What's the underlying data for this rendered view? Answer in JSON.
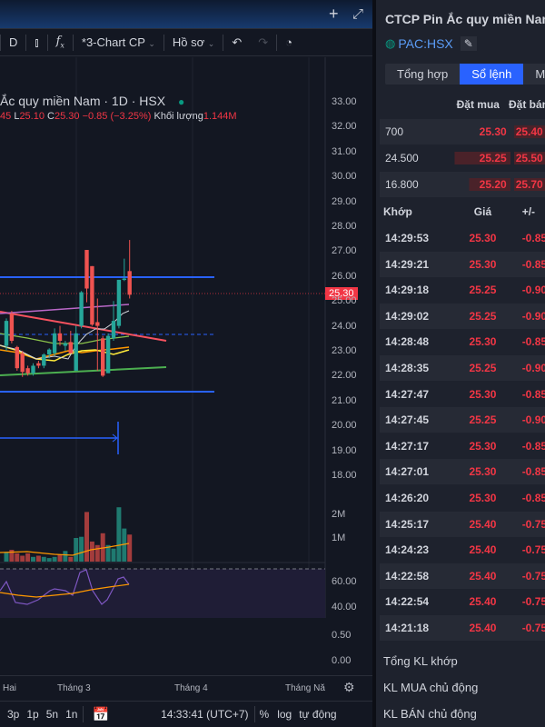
{
  "toolbar": {
    "interval": "D",
    "layout": "*3-Chart CP",
    "profile": "Hồ sơ"
  },
  "chart": {
    "title": "Ắc quy miền Nam · 1D · HSX",
    "ohlc": {
      "h": "45",
      "l_label": "L",
      "l": "25.10",
      "c_label": "C",
      "c": "25.30",
      "change": "−0.85 (−3.25%)",
      "vol_label": "Khối lượng",
      "vol": "1.144M"
    },
    "price_ticks": [
      "33.00",
      "32.00",
      "31.00",
      "30.00",
      "29.00",
      "28.00",
      "27.00",
      "26.00",
      "25.00",
      "24.00",
      "23.00",
      "22.00",
      "21.00",
      "20.00",
      "19.00",
      "18.00"
    ],
    "last_price": "25.30",
    "volume_ticks": [
      "2M",
      "1M"
    ],
    "rsi_ticks": [
      "60.00",
      "40.00"
    ],
    "macd_ticks": [
      "0.50",
      "0.00"
    ],
    "time_labels": [
      "Hai",
      "Tháng 3",
      "Tháng 4",
      "Tháng Nă"
    ]
  },
  "chart_data": {
    "type": "candlestick",
    "candles": [
      [
        23.2,
        24.3,
        23.0,
        24.2
      ],
      [
        24.5,
        24.6,
        23.3,
        23.4
      ],
      [
        23.15,
        23.2,
        22.2,
        22.3
      ],
      [
        22.9,
        23.0,
        21.95,
        22.15
      ],
      [
        22.3,
        22.4,
        22.0,
        22.1
      ],
      [
        22.1,
        22.5,
        22.0,
        22.4
      ],
      [
        22.5,
        22.6,
        22.3,
        22.4
      ],
      [
        22.4,
        22.9,
        22.3,
        22.85
      ],
      [
        22.85,
        23.1,
        22.7,
        23.05
      ],
      [
        22.9,
        23.9,
        22.8,
        23.7
      ],
      [
        23.7,
        24.0,
        23.2,
        23.4
      ],
      [
        23.2,
        23.4,
        23.0,
        23.3
      ],
      [
        23.35,
        23.8,
        22.9,
        22.9
      ],
      [
        22.2,
        24.0,
        22.2,
        23.7
      ],
      [
        24.0,
        25.4,
        23.9,
        25.35
      ],
      [
        27.05,
        27.05,
        24.95,
        25.5
      ],
      [
        26.4,
        26.4,
        24.0,
        24.05
      ],
      [
        24.15,
        25.1,
        22.2,
        24.0
      ],
      [
        23.5,
        23.6,
        21.95,
        22.0
      ],
      [
        22.1,
        23.7,
        22.1,
        23.6
      ],
      [
        23.5,
        25.0,
        23.4,
        24.2
      ],
      [
        24.0,
        25.85,
        23.9,
        25.85
      ],
      [
        25.85,
        26.7,
        25.8,
        25.9
      ],
      [
        26.2,
        27.45,
        25.1,
        25.25
      ]
    ],
    "volumes": [
      0.4,
      0.5,
      0.35,
      0.25,
      0.35,
      0.2,
      0.25,
      0.2,
      0.15,
      0.2,
      0.3,
      0.45,
      0.2,
      1.0,
      1.05,
      2.1,
      0.85,
      0.7,
      1.2,
      0.7,
      0.55,
      2.3,
      1.4,
      1.144
    ],
    "price_range": [
      18,
      33
    ]
  },
  "bottom": {
    "ranges": [
      "3p",
      "1p",
      "5n",
      "1n"
    ],
    "clock": "14:33:41 (UTC+7)",
    "percent": "%",
    "log": "log",
    "auto": "tự động"
  },
  "panel": {
    "company": "CTCP Pin Ắc quy miền Nam",
    "symbol": "PAC:HSX",
    "tabs": [
      "Tổng hợp",
      "Sổ lệnh",
      "Mức giá"
    ],
    "book_headers": [
      "Đặt mua",
      "Đặt bán"
    ],
    "book": [
      {
        "vol": "700",
        "bid": "25.30",
        "ask": "25.40"
      },
      {
        "vol": "24.500",
        "bid": "25.25",
        "ask": "25.50"
      },
      {
        "vol": "16.800",
        "bid": "25.20",
        "ask": "25.70"
      }
    ],
    "trade_headers": [
      "Khớp",
      "Giá",
      "+/-"
    ],
    "trades": [
      {
        "t": "14:29:53",
        "p": "25.30",
        "c": "-0.85"
      },
      {
        "t": "14:29:21",
        "p": "25.30",
        "c": "-0.85"
      },
      {
        "t": "14:29:18",
        "p": "25.25",
        "c": "-0.90"
      },
      {
        "t": "14:29:02",
        "p": "25.25",
        "c": "-0.90"
      },
      {
        "t": "14:28:48",
        "p": "25.30",
        "c": "-0.85"
      },
      {
        "t": "14:28:35",
        "p": "25.25",
        "c": "-0.90"
      },
      {
        "t": "14:27:47",
        "p": "25.30",
        "c": "-0.85"
      },
      {
        "t": "14:27:45",
        "p": "25.25",
        "c": "-0.90"
      },
      {
        "t": "14:27:17",
        "p": "25.30",
        "c": "-0.85"
      },
      {
        "t": "14:27:01",
        "p": "25.30",
        "c": "-0.85"
      },
      {
        "t": "14:26:20",
        "p": "25.30",
        "c": "-0.85"
      },
      {
        "t": "14:25:17",
        "p": "25.40",
        "c": "-0.75"
      },
      {
        "t": "14:24:23",
        "p": "25.40",
        "c": "-0.75"
      },
      {
        "t": "14:22:58",
        "p": "25.40",
        "c": "-0.75"
      },
      {
        "t": "14:22:54",
        "p": "25.40",
        "c": "-0.75"
      },
      {
        "t": "14:21:18",
        "p": "25.40",
        "c": "-0.75"
      }
    ],
    "footer": [
      "Tổng KL khớp",
      "KL MUA chủ động",
      "KL BÁN chủ động"
    ]
  },
  "colors": {
    "up": "#26a69a",
    "down": "#ef5350",
    "accent": "#2962ff",
    "bg": "#131722"
  }
}
